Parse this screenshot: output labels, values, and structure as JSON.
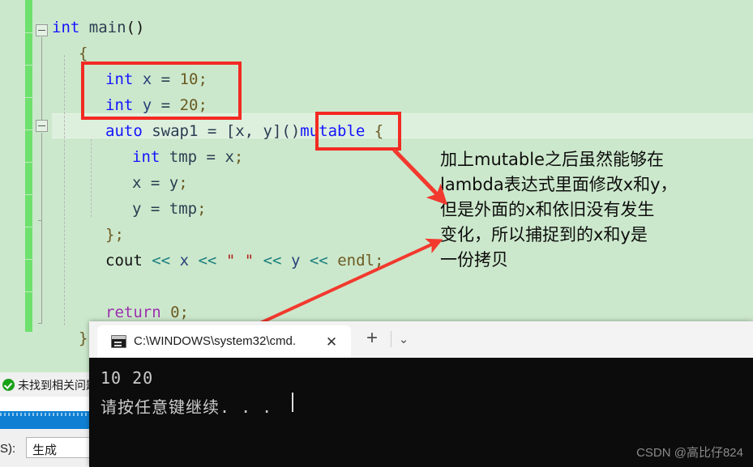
{
  "editor": {
    "background_color": "#cce8cc",
    "change_bar_color": "#6ee06e",
    "code_lines": [
      {
        "indent": 0,
        "tokens": [
          {
            "t": "int",
            "c": "kw"
          },
          {
            "t": " ",
            "c": "plain"
          },
          {
            "t": "main",
            "c": "id"
          },
          {
            "t": "()",
            "c": "plain"
          }
        ]
      },
      {
        "indent": 1,
        "tokens": [
          {
            "t": "{",
            "c": "punc"
          }
        ]
      },
      {
        "indent": 2,
        "tokens": [
          {
            "t": "int",
            "c": "kw"
          },
          {
            "t": " ",
            "c": "plain"
          },
          {
            "t": "x",
            "c": "var"
          },
          {
            "t": " = ",
            "c": "op"
          },
          {
            "t": "10",
            "c": "num"
          },
          {
            "t": ";",
            "c": "punc"
          }
        ]
      },
      {
        "indent": 2,
        "tokens": [
          {
            "t": "int",
            "c": "kw"
          },
          {
            "t": " ",
            "c": "plain"
          },
          {
            "t": "y",
            "c": "var"
          },
          {
            "t": " = ",
            "c": "op"
          },
          {
            "t": "20",
            "c": "num"
          },
          {
            "t": ";",
            "c": "punc"
          }
        ]
      },
      {
        "indent": 2,
        "tokens": [
          {
            "t": "auto",
            "c": "kw"
          },
          {
            "t": " ",
            "c": "plain"
          },
          {
            "t": "swap1",
            "c": "id"
          },
          {
            "t": " = ",
            "c": "op"
          },
          {
            "t": "[x, y]()",
            "c": "id"
          },
          {
            "t": "mutable",
            "c": "kw"
          },
          {
            "t": " ",
            "c": "plain"
          },
          {
            "t": "{",
            "c": "punc"
          }
        ]
      },
      {
        "indent": 3,
        "tokens": [
          {
            "t": "int",
            "c": "kw"
          },
          {
            "t": " ",
            "c": "plain"
          },
          {
            "t": "tmp",
            "c": "id"
          },
          {
            "t": " = ",
            "c": "op"
          },
          {
            "t": "x",
            "c": "id"
          },
          {
            "t": ";",
            "c": "punc"
          }
        ]
      },
      {
        "indent": 3,
        "tokens": [
          {
            "t": "x",
            "c": "id"
          },
          {
            "t": " = ",
            "c": "op"
          },
          {
            "t": "y",
            "c": "id"
          },
          {
            "t": ";",
            "c": "punc"
          }
        ]
      },
      {
        "indent": 3,
        "tokens": [
          {
            "t": "y",
            "c": "id"
          },
          {
            "t": " = ",
            "c": "op"
          },
          {
            "t": "tmp",
            "c": "id"
          },
          {
            "t": ";",
            "c": "punc"
          }
        ]
      },
      {
        "indent": 2,
        "tokens": [
          {
            "t": "}",
            "c": "punc"
          },
          {
            "t": ";",
            "c": "punc"
          }
        ]
      },
      {
        "indent": 2,
        "tokens": [
          {
            "t": "cout",
            "c": "plain"
          },
          {
            "t": " ",
            "c": "plain"
          },
          {
            "t": "<<",
            "c": "teal"
          },
          {
            "t": " ",
            "c": "plain"
          },
          {
            "t": "x",
            "c": "var"
          },
          {
            "t": " ",
            "c": "plain"
          },
          {
            "t": "<<",
            "c": "teal"
          },
          {
            "t": " ",
            "c": "plain"
          },
          {
            "t": "\" \"",
            "c": "str"
          },
          {
            "t": " ",
            "c": "plain"
          },
          {
            "t": "<<",
            "c": "teal"
          },
          {
            "t": " ",
            "c": "plain"
          },
          {
            "t": "y",
            "c": "var"
          },
          {
            "t": " ",
            "c": "plain"
          },
          {
            "t": "<<",
            "c": "teal"
          },
          {
            "t": " ",
            "c": "plain"
          },
          {
            "t": "endl",
            "c": "type"
          },
          {
            "t": ";",
            "c": "punc"
          }
        ]
      },
      {
        "indent": 2,
        "tokens": []
      },
      {
        "indent": 2,
        "tokens": [
          {
            "t": "return",
            "c": "kw2"
          },
          {
            "t": " ",
            "c": "plain"
          },
          {
            "t": "0",
            "c": "num"
          },
          {
            "t": ";",
            "c": "punc"
          }
        ]
      },
      {
        "indent": 1,
        "tokens": [
          {
            "t": "}",
            "c": "punc"
          }
        ]
      }
    ],
    "code_plain": [
      "int main()",
      "{",
      "    int x = 10;",
      "    int y = 20;",
      "    auto swap1 = [x, y]()mutable {",
      "        int tmp = x;",
      "        x = y;",
      "        y = tmp;",
      "    };",
      "    cout << x << \" \" << y << endl;",
      "",
      "    return 0;",
      "}"
    ]
  },
  "annotations": {
    "highlight_color": "#f22a22",
    "box_vars_label": "int x = 10; int y = 20;",
    "box_mutable_label": "mutable",
    "note_text": "加上mutable之后虽然能够在\nlambda表达式里面修改x和y，\n但是外面的x和依旧没有发生\n变化，所以捕捉到的x和y是\n一份拷贝"
  },
  "terminal": {
    "tab_title": "C:\\WINDOWS\\system32\\cmd.",
    "close_label": "✕",
    "new_tab_label": "+",
    "dropdown_label": "⌄",
    "output_line1": "10 20",
    "output_line2": "请按任意键继续. . .",
    "background_color": "#0c0c0c"
  },
  "vs_status": {
    "error_list_text": "未找到相关问题",
    "combo_prefix": "S):",
    "combo_value": "生成"
  },
  "watermark": {
    "text": "CSDN @高比仔824"
  }
}
